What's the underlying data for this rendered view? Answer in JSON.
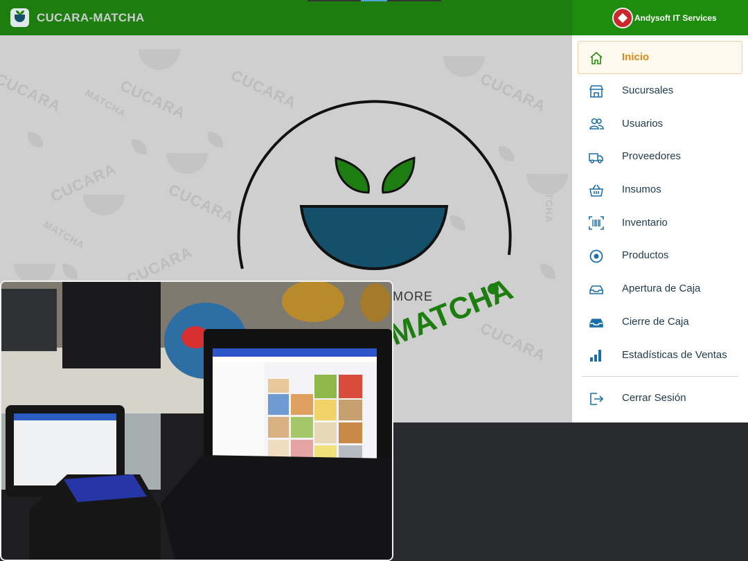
{
  "app": {
    "title": "CUCARA-MATCHA"
  },
  "brand": {
    "name": "Andysoft IT Services"
  },
  "background_logo": {
    "tagline": "MORE",
    "wordmark": "MATCHA",
    "pattern_word_1": "CUCARA",
    "pattern_word_2": "MATCHA"
  },
  "menu": {
    "items": [
      {
        "label": "Inicio",
        "icon": "home-icon",
        "active": true
      },
      {
        "label": "Sucursales",
        "icon": "store-icon",
        "active": false
      },
      {
        "label": "Usuarios",
        "icon": "users-icon",
        "active": false
      },
      {
        "label": "Proveedores",
        "icon": "truck-icon",
        "active": false
      },
      {
        "label": "Insumos",
        "icon": "basket-icon",
        "active": false
      },
      {
        "label": "Inventario",
        "icon": "barcode-icon",
        "active": false
      },
      {
        "label": "Productos",
        "icon": "product-icon",
        "active": false
      },
      {
        "label": "Apertura de Caja",
        "icon": "open-box-icon",
        "active": false
      },
      {
        "label": "Cierre de Caja",
        "icon": "closed-box-icon",
        "active": false
      },
      {
        "label": "Estadísticas de Ventas",
        "icon": "bar-chart-icon",
        "active": false
      }
    ],
    "logout": {
      "label": "Cerrar Sesión",
      "icon": "logout-icon"
    }
  },
  "colors": {
    "appbar": "#1e7d0f",
    "drawer_header": "#1e8d0d",
    "active_label": "#d68a17",
    "icon": "#1b6fa8",
    "bowl": "#15506a"
  }
}
